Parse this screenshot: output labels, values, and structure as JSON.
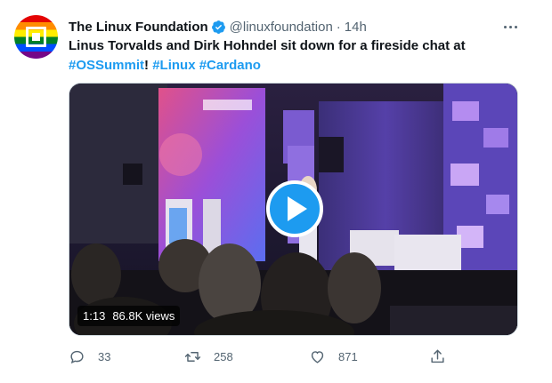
{
  "author": {
    "display_name": "The Linux Foundation",
    "handle": "@linuxfoundation",
    "separator": "·",
    "time": "14h",
    "verified_icon": "verified-badge-icon"
  },
  "tweet": {
    "text_start": "Linus Torvalds and Dirk Hohndel sit down for a fireside chat at ",
    "hashtag_1": "#OSSummit",
    "text_mid": "! ",
    "hashtag_2": "#Linux",
    "space": " ",
    "hashtag_3": "#Cardano"
  },
  "media": {
    "duration": "1:13",
    "views": "86.8K views",
    "play_icon": "play-icon"
  },
  "actions": {
    "reply_count": "33",
    "retweet_count": "258",
    "like_count": "871"
  },
  "colors": {
    "accent": "#1d9bf0",
    "muted": "#536471",
    "text": "#0f1419"
  }
}
